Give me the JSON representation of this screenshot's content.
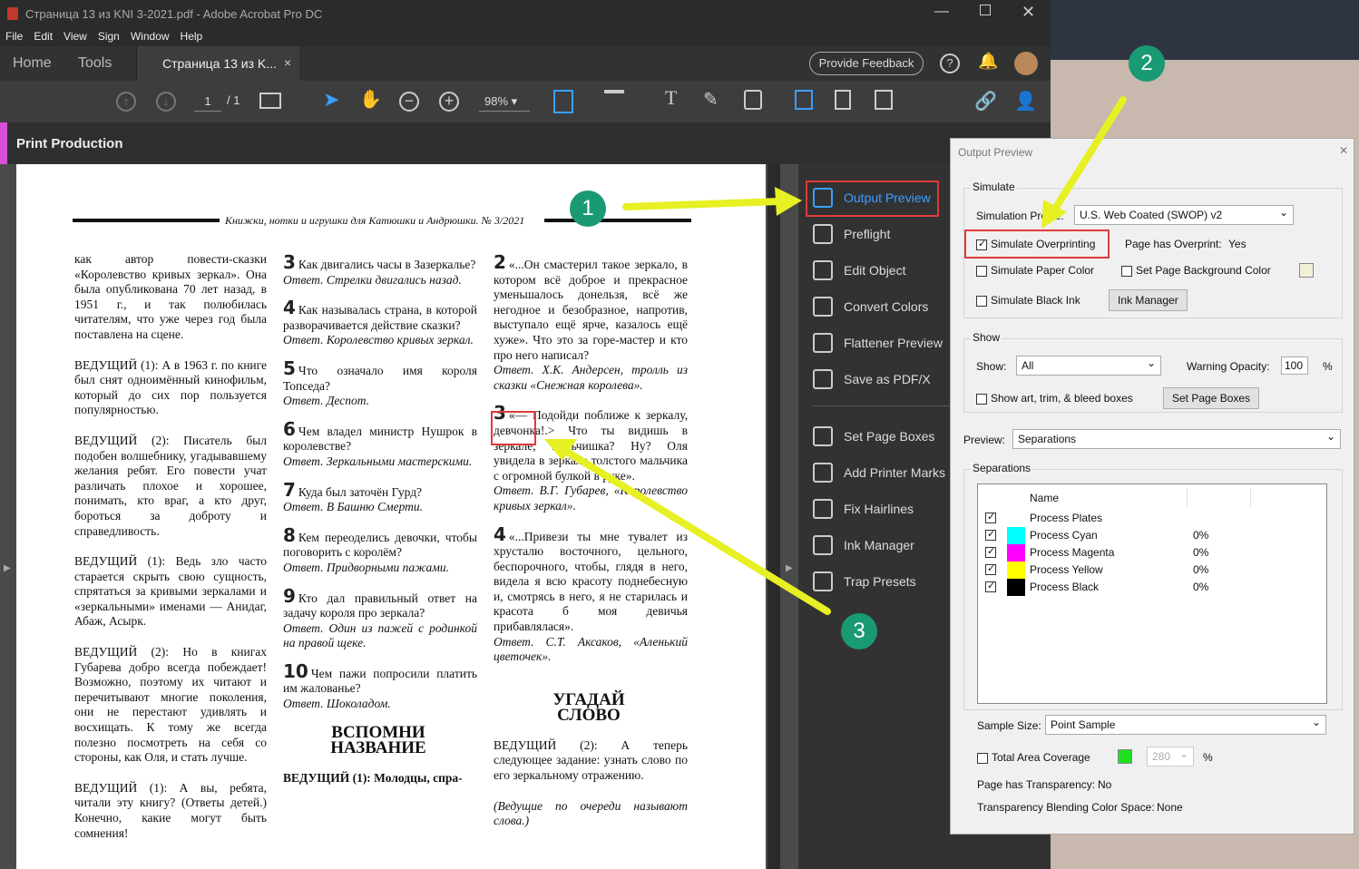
{
  "window": {
    "title": "Страница 13 из KNI 3-2021.pdf - Adobe Acrobat Pro DC"
  },
  "menu": [
    "File",
    "Edit",
    "View",
    "Sign",
    "Window",
    "Help"
  ],
  "tabs": {
    "home": "Home",
    "tools": "Tools",
    "doc": "Страница 13 из K...",
    "close": "×",
    "feedback": "Provide Feedback"
  },
  "toolbar": {
    "page": "1",
    "total": "/ 1",
    "zoom": "98%"
  },
  "print_production": "Print Production",
  "tools": [
    "Output Preview",
    "Preflight",
    "Edit Object",
    "Convert Colors",
    "Flattener Preview",
    "Save as PDF/X",
    "Set Page Boxes",
    "Add Printer Marks",
    "Fix Hairlines",
    "Ink Manager",
    "Trap Presets"
  ],
  "document": {
    "header": "Книжки, нотки и игрушки для Катюшки и Андрюшки. № 3/2021",
    "col1": [
      "как автор повести-сказки «Королевство кривых зеркал». Она была опубликована 70 лет назад, в 1951 г., и так полюбилась читателям, что уже через год была поставлена на сцене.",
      "ВЕДУЩИЙ (1): А в 1963 г. по книге был снят одноимённый кинофильм, который до сих пор пользуется популярностью.",
      "ВЕДУЩИЙ (2): Писатель был подобен волшебнику, угадывавшему желания ребят. Его повести учат различать плохое и хорошее, понимать, кто враг, а кто друг, бороться за доброту и справедливость.",
      "ВЕДУЩИЙ (1): Ведь зло часто старается скрыть свою сущность, спрятаться за кривыми зеркалами и «зеркальными» именами — Анидаг, Абаж, Асырк.",
      "ВЕДУЩИЙ (2): Но в книгах Губарева добро всегда побеждает! Возможно, поэтому их читают и перечитывают многие поколения, они не перестают удивлять и восхищать. К тому же всегда полезно посмотреть на себя со стороны, как Оля, и стать лучше.",
      "ВЕДУЩИЙ (1): А вы, ребята, читали эту книгу? (Ответы детей.) Конечно, какие могут быть сомнения!"
    ],
    "col2": [
      {
        "n": "3",
        "q": "Как двигались часы в Зазеркалье?",
        "a": "Ответ. Стрелки двигались назад."
      },
      {
        "n": "4",
        "q": "Как называлась страна, в которой разворачивается действие сказки?",
        "a": "Ответ. Королевство кривых зеркал."
      },
      {
        "n": "5",
        "q": "Что означало имя короля Топседа?",
        "a": "Ответ. Деспот."
      },
      {
        "n": "6",
        "q": "Чем владел министр Нушрок в королевстве?",
        "a": "Ответ. Зеркальными мастерскими."
      },
      {
        "n": "7",
        "q": "Куда был заточён Гурд?",
        "a": "Ответ. В Башню Смерти."
      },
      {
        "n": "8",
        "q": "Кем переоделись девочки, чтобы поговорить с королём?",
        "a": "Ответ. Придворными пажами."
      },
      {
        "n": "9",
        "q": "Кто дал правильный ответ на задачу короля про зеркала?",
        "a": "Ответ. Один из пажей с родинкой на правой щеке."
      },
      {
        "n": "10",
        "q": "Чем пажи попросили платить им жалованье?",
        "a": "Ответ. Шоколадом."
      }
    ],
    "col2_heading": "ВСПОМНИ НАЗВАНИЕ",
    "col2_tail": "ВЕДУЩИЙ (1): Молодцы, спра-",
    "col3": [
      {
        "n": "2",
        "q": "«...Он смастерил такое зеркало, в котором всё доброе и прекрасное уменьшалось донельзя, всё же негодное и безобразное, напротив, выступало ещё ярче, казалось ещё хуже». Что это за горе-мастер и кто про него написал?",
        "a": "Ответ. Х.К. Андерсен, тролль из сказки «Снежная королева»."
      },
      {
        "n": "3",
        "q": "«— Подойди поближе к зеркалу, девчонка!.> Что ты видишь в зеркале, мальчишка? Ну? Оля увидела в зеркале толстого мальчика с огромной булкой в руке».",
        "a": "Ответ. В.Г. Губарев, «Королевство кривых зеркал»."
      },
      {
        "n": "4",
        "q": "«...Привези ты мне тувалет из хрусталю восточного, цельного, беспорочного, чтобы, глядя в него, видела я всю красоту поднебесную и, смотрясь в него, я не старилась и красота б моя девичья прибавлялася».",
        "a": "Ответ. С.Т. Аксаков, «Аленький цветочек»."
      }
    ],
    "col3_heading": "УГАДАЙ СЛОВО",
    "col3_tail1": "ВЕДУЩИЙ (2): А теперь следующее задание: узнать слово по его зеркальному отражению.",
    "col3_tail2": "(Ведущие по очереди называют слова.)"
  },
  "dialog": {
    "title": "Output Preview",
    "simulate": "Simulate",
    "sim_profile_label": "Simulation Profile:",
    "sim_profile": "U.S. Web Coated (SWOP) v2",
    "sim_overprint": "Simulate Overprinting",
    "page_overprint_label": "Page has Overprint:",
    "page_overprint": "Yes",
    "sim_paper": "Simulate Paper Color",
    "set_bg": "Set Page Background Color",
    "sim_black": "Simulate Black Ink",
    "ink_manager": "Ink Manager",
    "show_group": "Show",
    "show_label": "Show:",
    "show_value": "All",
    "warn_label": "Warning Opacity:",
    "warn_value": "100",
    "pct": "%",
    "show_boxes": "Show art, trim, & bleed boxes",
    "set_boxes": "Set Page Boxes",
    "preview_label": "Preview:",
    "preview_value": "Separations",
    "separations": "Separations",
    "sep_header": "Name",
    "seps": [
      {
        "name": "Process Plates",
        "val": "",
        "color": ""
      },
      {
        "name": "Process Cyan",
        "val": "0%",
        "color": "#00ffff"
      },
      {
        "name": "Process Magenta",
        "val": "0%",
        "color": "#ff00ff"
      },
      {
        "name": "Process Yellow",
        "val": "0%",
        "color": "#ffff00"
      },
      {
        "name": "Process Black",
        "val": "0%",
        "color": "#000000"
      }
    ],
    "sample_label": "Sample Size:",
    "sample_value": "Point Sample",
    "tac": "Total Area Coverage",
    "tac_value": "280",
    "transp_label": "Page has Transparency:",
    "transp": "No",
    "blend_label": "Transparency Blending Color Space:",
    "blend": "None"
  },
  "badges": [
    "1",
    "2",
    "3"
  ]
}
